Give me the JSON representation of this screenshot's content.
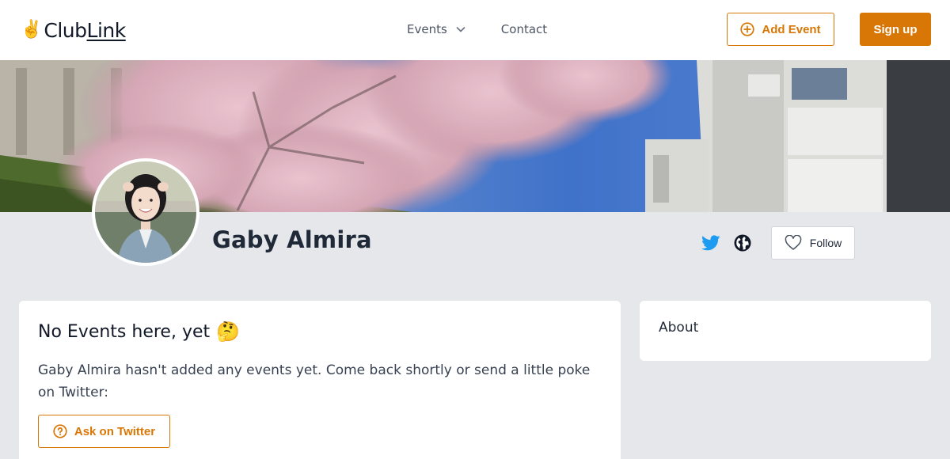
{
  "header": {
    "logo": {
      "emoji": "✌️",
      "name_part1": "Club",
      "name_part2": "Link"
    },
    "nav": {
      "events_label": "Events",
      "contact_label": "Contact"
    },
    "add_event_label": "Add Event",
    "signup_label": "Sign up"
  },
  "profile": {
    "name": "Gaby Almira",
    "follow_label": "Follow"
  },
  "events_card": {
    "title": "No Events here, yet",
    "title_emoji": "🤔",
    "message": "Gaby Almira hasn't added any events yet. Come back shortly or send a little poke on Twitter:",
    "ask_button_label": "Ask on Twitter"
  },
  "about_card": {
    "title": "About"
  },
  "colors": {
    "accent": "#d97706",
    "twitter": "#1d9bf0",
    "page_bg": "#e5e7eb"
  },
  "icons": {
    "events_chevron": "chevron-down-icon",
    "add_event": "plus-circle-icon",
    "twitter": "twitter-icon",
    "website": "globe-icon",
    "follow": "heart-icon",
    "ask": "question-circle-icon"
  }
}
